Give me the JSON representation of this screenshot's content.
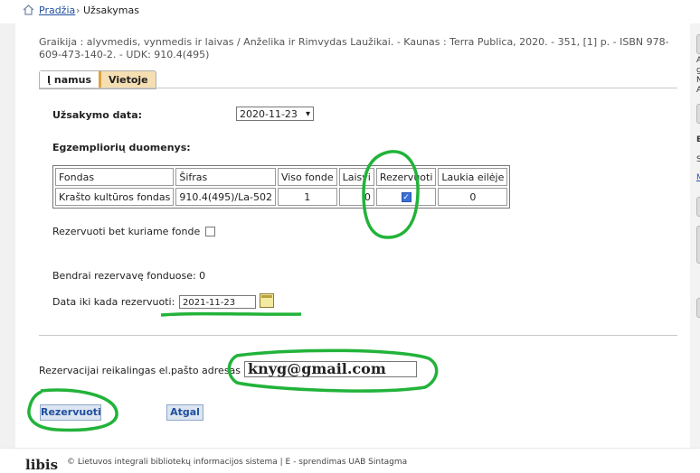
{
  "breadcrumb": {
    "home_label": "Pradžia",
    "separator": "›",
    "current": "Užsakymas"
  },
  "book_info": "Graikija : alyvmedis, vynmedis ir laivas / Anželika ir Rimvydas Laužikai. - Kaunas : Terra Publica, 2020. - 351, [1] p. - ISBN 978-609-473-140-2. - UDK: 910.4(495)",
  "tabs": [
    {
      "label": "Į namus",
      "active": true
    },
    {
      "label": "Vietoje",
      "active": false
    }
  ],
  "order_date": {
    "label": "Užsakymo data:",
    "value": "2020-11-23"
  },
  "copies": {
    "heading": "Egzempliorių duomenys:",
    "columns": [
      "Fondas",
      "Šifras",
      "Viso fonde",
      "Laisvi",
      "Rezervuoti",
      "Laukia eilėje"
    ],
    "rows": [
      {
        "fondas": "Krašto kultūros fondas",
        "sifras": "910.4(495)/La-502",
        "viso": "1",
        "laisvi": "0",
        "rezervuoti_checked": true,
        "laukia": "0"
      }
    ]
  },
  "reserve_any": {
    "label": "Rezervuoti bet kuriame fonde",
    "checked": false
  },
  "total_reserved": "Bendrai rezervavę fonduose: 0",
  "reserve_until": {
    "label": "Data iki kada rezervuoti:",
    "value": "2021-11-23"
  },
  "email": {
    "label": "Rezervacijai reikalingas el.pašto adresas",
    "value": "knyg@gmail.com"
  },
  "buttons": {
    "reserve": "Rezervuoti",
    "back": "Atgal"
  },
  "right_panel_letters": [
    "A",
    "g",
    "N",
    "A",
    "E",
    "S",
    "M"
  ],
  "footer": {
    "logo": "libis",
    "text": "© Lietuvos integrali bibliotekų informacijos sistema | E - sprendimas UAB Sintagma"
  },
  "colors": {
    "link": "#1f4f9e",
    "tab_bg": "#f5deb1",
    "tab_accent": "#d9a441",
    "annotation": "#22b33a",
    "button_bg": "#dce5f1"
  }
}
